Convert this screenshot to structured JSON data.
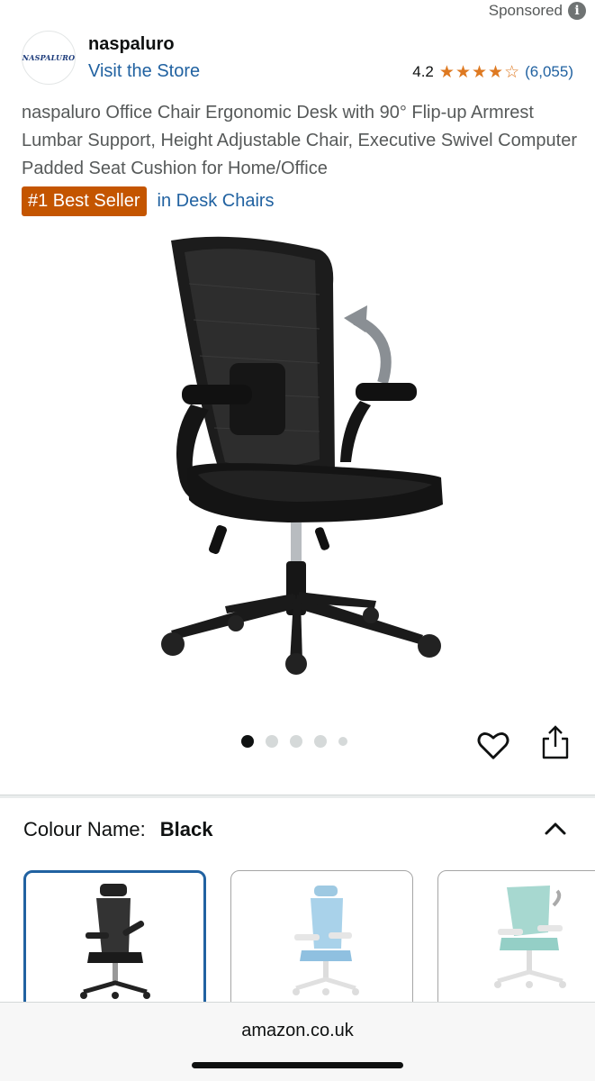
{
  "sponsored": {
    "label": "Sponsored",
    "info_icon": "i"
  },
  "brand": {
    "logo_text": "NASPALURO",
    "name": "naspaluro",
    "visit_store": "Visit the Store",
    "rating_value": "4.2",
    "stars": [
      1,
      1,
      1,
      1,
      0
    ],
    "rating_count": "(6,055)"
  },
  "product": {
    "title": "naspaluro Office Chair Ergonomic Desk with 90° Flip-up Armrest Lumbar Support, Height Adjustable Chair, Executive Swivel Computer Padded Seat Cushion for Home/Office",
    "badge": "#1 Best Seller",
    "badge_category": "in Desk Chairs"
  },
  "carousel": {
    "total": 5,
    "active_index": 0
  },
  "actions": {
    "wishlist_icon": "heart-icon",
    "share_icon": "share-icon"
  },
  "variant": {
    "label": "Colour Name:",
    "value": "Black",
    "swatches": [
      {
        "color": "black",
        "selected": true
      },
      {
        "color": "light-blue",
        "selected": false
      },
      {
        "color": "mint",
        "selected": false
      }
    ]
  },
  "browser": {
    "url": "amazon.co.uk"
  },
  "colors": {
    "accent_link": "#2162a1",
    "badge_bg": "#c45500",
    "star": "#de7921"
  }
}
